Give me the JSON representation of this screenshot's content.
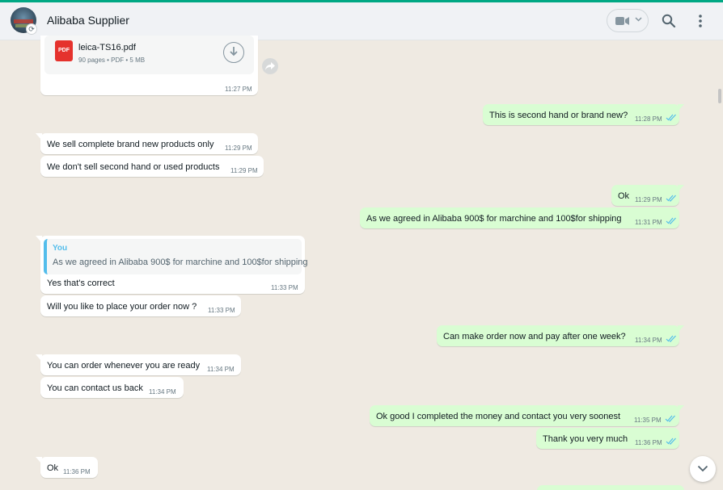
{
  "header": {
    "contact_name": "Alibaba Supplier",
    "icons": [
      "avatar",
      "video-call-icon",
      "chevron-down-icon",
      "search-icon",
      "menu-icon"
    ]
  },
  "document": {
    "file_name": "leica-TS16.pdf",
    "file_meta": "90 pages • PDF • 5 MB",
    "type_badge": "PDF",
    "time": "11:27 PM"
  },
  "messages": [
    {
      "dir": "out",
      "text": "This is second hand or brand new?",
      "time": "11:28 PM"
    },
    {
      "dir": "in",
      "text": "We sell complete brand new products only",
      "time": "11:29 PM"
    },
    {
      "dir": "in",
      "text": "We don't sell second hand or used products",
      "time": "11:29 PM"
    },
    {
      "dir": "out",
      "text": "Ok",
      "time": "11:29 PM"
    },
    {
      "dir": "out",
      "text": "As we agreed in Alibaba 900$ for marchine and 100$for shipping",
      "time": "11:31 PM"
    },
    {
      "dir": "in",
      "text": "Yes that's correct",
      "time": "11:33 PM",
      "quote_author": "You",
      "quote_text": "As we agreed in Alibaba 900$ for marchine and 100$for shipping"
    },
    {
      "dir": "in",
      "text": "Will you like to place your order now ?",
      "time": "11:33 PM"
    },
    {
      "dir": "out",
      "text": "Can make order now and pay after one week?",
      "time": "11:34 PM"
    },
    {
      "dir": "in",
      "text": "You can order whenever you are ready",
      "time": "11:34 PM"
    },
    {
      "dir": "in",
      "text": "You can contact us back",
      "time": "11:34 PM"
    },
    {
      "dir": "out",
      "text": "Ok good I completed the money and contact you very soonest",
      "time": "11:35 PM"
    },
    {
      "dir": "out",
      "text": "Thank you very much",
      "time": "11:36 PM"
    },
    {
      "dir": "in",
      "text": "Ok",
      "time": "11:36 PM"
    }
  ],
  "colors": {
    "incoming": "#ffffff",
    "outgoing": "#d9fdd3",
    "read_ticks": "#53bdeb",
    "background": "#efeae2",
    "accent": "#00a884"
  }
}
